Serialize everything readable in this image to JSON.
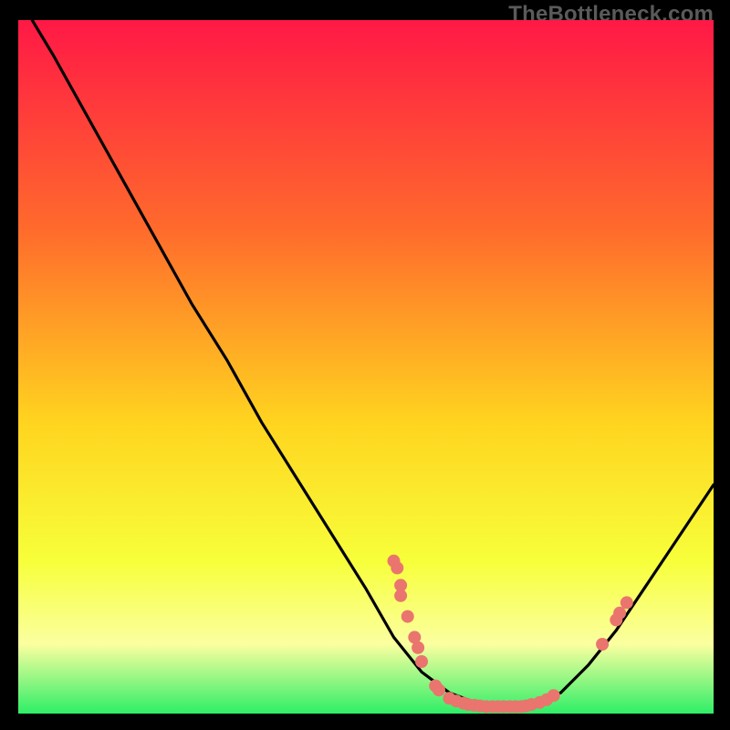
{
  "watermark": "TheBottleneck.com",
  "colors": {
    "gradient_top": "#ff1846",
    "gradient_mid_upper": "#ff6a2c",
    "gradient_mid": "#ffd41f",
    "gradient_mid_lower": "#f7ff3a",
    "gradient_band_light": "#fbffa0",
    "gradient_bottom": "#2eee67",
    "curve": "#000000",
    "marker": "#e9756e",
    "bg": "#000000"
  },
  "chart_data": {
    "type": "line",
    "title": "",
    "xlabel": "",
    "ylabel": "",
    "xlim": [
      0,
      100
    ],
    "ylim": [
      0,
      100
    ],
    "curve": [
      {
        "x": 2,
        "y": 100
      },
      {
        "x": 5,
        "y": 95
      },
      {
        "x": 10,
        "y": 86
      },
      {
        "x": 15,
        "y": 77
      },
      {
        "x": 20,
        "y": 68
      },
      {
        "x": 25,
        "y": 59
      },
      {
        "x": 30,
        "y": 51
      },
      {
        "x": 35,
        "y": 42
      },
      {
        "x": 40,
        "y": 34
      },
      {
        "x": 45,
        "y": 26
      },
      {
        "x": 50,
        "y": 18
      },
      {
        "x": 54,
        "y": 11
      },
      {
        "x": 58,
        "y": 6
      },
      {
        "x": 62,
        "y": 3
      },
      {
        "x": 66,
        "y": 1.5
      },
      {
        "x": 70,
        "y": 1
      },
      {
        "x": 74,
        "y": 1.5
      },
      {
        "x": 78,
        "y": 3
      },
      {
        "x": 82,
        "y": 7
      },
      {
        "x": 86,
        "y": 12
      },
      {
        "x": 90,
        "y": 18
      },
      {
        "x": 94,
        "y": 24
      },
      {
        "x": 98,
        "y": 30
      },
      {
        "x": 100,
        "y": 33
      }
    ],
    "markers": [
      {
        "x": 54,
        "y": 22
      },
      {
        "x": 54.5,
        "y": 21
      },
      {
        "x": 55,
        "y": 18.5
      },
      {
        "x": 55,
        "y": 17
      },
      {
        "x": 56,
        "y": 14
      },
      {
        "x": 57,
        "y": 11
      },
      {
        "x": 57.5,
        "y": 9.5
      },
      {
        "x": 58,
        "y": 7.5
      },
      {
        "x": 60,
        "y": 4
      },
      {
        "x": 60.5,
        "y": 3.4
      },
      {
        "x": 62,
        "y": 2.2
      },
      {
        "x": 63,
        "y": 1.8
      },
      {
        "x": 64,
        "y": 1.5
      },
      {
        "x": 64.7,
        "y": 1.3
      },
      {
        "x": 65.6,
        "y": 1.2
      },
      {
        "x": 66.4,
        "y": 1.1
      },
      {
        "x": 67.3,
        "y": 1.0
      },
      {
        "x": 68.2,
        "y": 1.0
      },
      {
        "x": 69,
        "y": 1.0
      },
      {
        "x": 69.8,
        "y": 1.0
      },
      {
        "x": 70.7,
        "y": 1.0
      },
      {
        "x": 71.5,
        "y": 1.0
      },
      {
        "x": 72.3,
        "y": 1.0
      },
      {
        "x": 73,
        "y": 1.1
      },
      {
        "x": 73.8,
        "y": 1.3
      },
      {
        "x": 75,
        "y": 1.6
      },
      {
        "x": 76,
        "y": 2.0
      },
      {
        "x": 77,
        "y": 2.6
      },
      {
        "x": 84,
        "y": 10
      },
      {
        "x": 86,
        "y": 13.5
      },
      {
        "x": 86.5,
        "y": 14.5
      },
      {
        "x": 87.5,
        "y": 16
      }
    ]
  }
}
